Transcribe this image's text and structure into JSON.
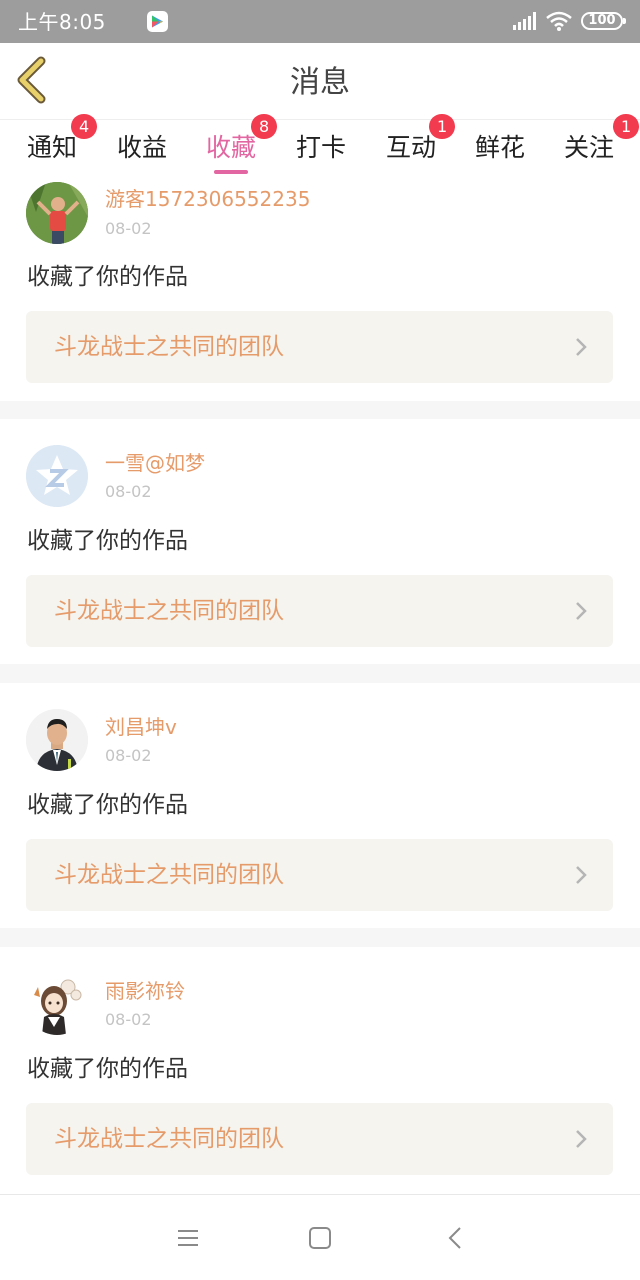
{
  "status_bar": {
    "time": "上午8:05",
    "battery": "100"
  },
  "header": {
    "title": "消息"
  },
  "tabs": [
    {
      "label": "通知",
      "badge": "4"
    },
    {
      "label": "收益",
      "badge": ""
    },
    {
      "label": "收藏",
      "badge": "8"
    },
    {
      "label": "打卡",
      "badge": ""
    },
    {
      "label": "互动",
      "badge": "1"
    },
    {
      "label": "鲜花",
      "badge": ""
    },
    {
      "label": "关注",
      "badge": "1"
    }
  ],
  "active_tab": "收藏",
  "items": [
    {
      "user": "游客1572306552235",
      "date": "08-02",
      "action": "收藏了你的作品",
      "work": "斗龙战士之共同的团队"
    },
    {
      "user": "一雪@如梦",
      "date": "08-02",
      "action": "收藏了你的作品",
      "work": "斗龙战士之共同的团队"
    },
    {
      "user": "刘昌坤v",
      "date": "08-02",
      "action": "收藏了你的作品",
      "work": "斗龙战士之共同的团队"
    },
    {
      "user": "雨影祢铃",
      "date": "08-02",
      "action": "收藏了你的作品",
      "work": "斗龙战士之共同的团队"
    }
  ],
  "icons": {
    "back": "chevron-left-icon",
    "nav_menu": "menu-icon",
    "nav_home": "square-icon",
    "nav_back": "back-arrow-icon"
  },
  "colors": {
    "accent": "#e266a1",
    "badge": "#f33b4f",
    "name_orange": "#e69b6a",
    "back_icon": "#e8d06a"
  }
}
